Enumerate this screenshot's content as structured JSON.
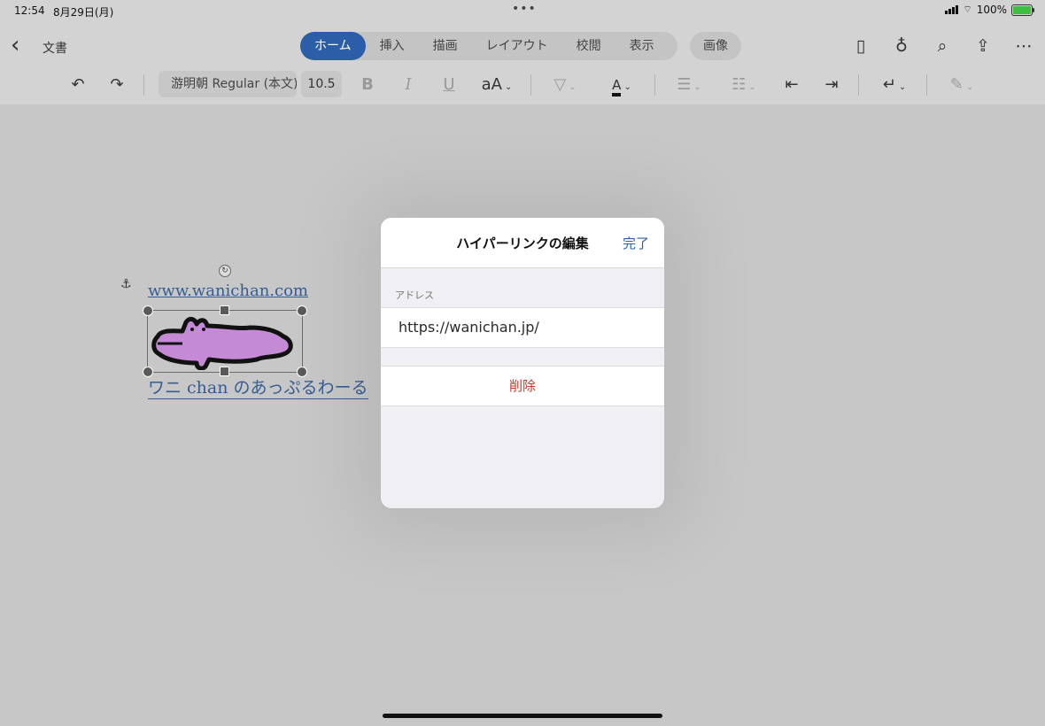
{
  "status": {
    "time": "12:54",
    "date": "8月29日(月)",
    "battery": "100%"
  },
  "nav": {
    "back_icon": "chevron-left-icon",
    "title": "文書",
    "tabs": [
      "ホーム",
      "挿入",
      "描画",
      "レイアウト",
      "校閲",
      "表示"
    ],
    "active_tab": "ホーム",
    "context_tab": "画像",
    "icons": [
      "phone-icon",
      "lightbulb-icon",
      "search-icon",
      "share-icon",
      "more-icon"
    ]
  },
  "toolbar": {
    "font_name": "游明朝 Regular (本文)",
    "font_size": "10.5",
    "bold": "B",
    "italic": "I",
    "underline": "U",
    "text_size": "aA"
  },
  "document": {
    "link_url_text": "www.wanichan.com",
    "link_title_text": "ワニ chan のあっぷるわーる"
  },
  "modal": {
    "title": "ハイパーリンクの編集",
    "done": "完了",
    "address_label": "アドレス",
    "address_value": "https://wanichan.jp/",
    "delete": "削除"
  },
  "colors": {
    "accent": "#2b5ea7",
    "delete": "#c0392b",
    "link": "#355d93",
    "croc": "#c58ad6"
  }
}
